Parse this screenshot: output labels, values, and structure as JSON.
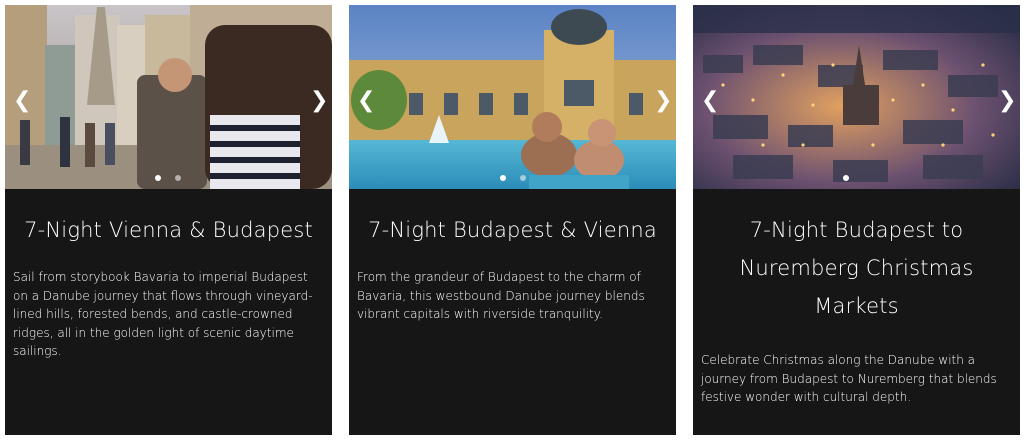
{
  "cards": [
    {
      "title": "7-Night Vienna & Budapest",
      "description": "Sail from storybook Bavaria to imperial Budapest on a Danube journey that flows through vineyard-lined hills, forested bends, and castle-crowned ridges, all in the golden light of scenic daytime sailings.",
      "image_alt": "Vienna street scene",
      "prev_icon": "chevron-left-icon",
      "next_icon": "chevron-right-icon",
      "prev_glyph": "❮",
      "next_glyph": "❯",
      "slide_count": 3,
      "active_slide": 1
    },
    {
      "title": "7-Night Budapest & Vienna",
      "description": "From the grandeur of Budapest to the charm of Bavaria, this westbound Danube journey blends vibrant capitals with riverside tranquility.",
      "image_alt": "Budapest thermal bath",
      "prev_icon": "chevron-left-icon",
      "next_icon": "chevron-right-icon",
      "prev_glyph": "❮",
      "next_glyph": "❯",
      "slide_count": 2,
      "active_slide": 1
    },
    {
      "title": "7-Night Budapest to Nuremberg Christmas Markets",
      "description": "Celebrate Christmas along the Danube with a journey from Budapest to Nuremberg that blends festive wonder with cultural depth.",
      "image_alt": "Nuremberg at night",
      "prev_icon": "chevron-left-icon",
      "next_icon": "chevron-right-icon",
      "prev_glyph": "❮",
      "next_glyph": "❯",
      "slide_count": 1,
      "active_slide": 1
    }
  ],
  "colors": {
    "card_background": "#171616",
    "text": "#ffffff",
    "page_background": "#ffffff"
  }
}
